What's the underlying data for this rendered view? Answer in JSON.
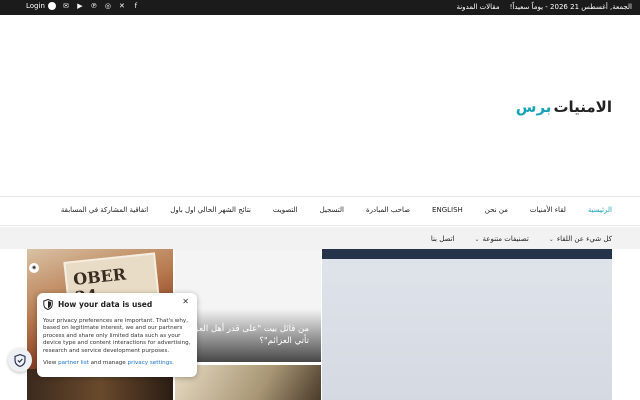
{
  "topbar": {
    "date": "الجمعة, أغسطس 21 2026 - يوماً سعيداً!",
    "blog_articles": "مقالات المدونة",
    "login": "Login",
    "social_icons": [
      "facebook-icon",
      "x-icon",
      "instagram-icon",
      "pinterest-icon",
      "youtube-icon",
      "email-icon"
    ]
  },
  "logo": {
    "part1": "الامنيات",
    "part2": "برس"
  },
  "nav_main": [
    {
      "label": "الرئيسية",
      "active": true
    },
    {
      "label": "لقاء الأمنيات"
    },
    {
      "label": "من نحن"
    },
    {
      "label": "ENGLISH"
    },
    {
      "label": "صاحب المبادرة"
    },
    {
      "label": "التسجيل"
    },
    {
      "label": "التصويت"
    },
    {
      "label": "نتائج الشهر الحالي اول باول"
    },
    {
      "label": "اتفاقية المشاركة في المسابقة"
    }
  ],
  "nav_sub": [
    {
      "label": "كل شيء عن اللقاء"
    },
    {
      "label": "تصنيفات متنوعة"
    },
    {
      "label": "اتصل بنا"
    }
  ],
  "cards": {
    "card1_poster_text": "OBER\n24",
    "card2_caption": "من قائل بيت \"على قدر أهل العزم تأتي العزائم\"؟"
  },
  "privacy": {
    "title": "How your data is used",
    "body": "Your privacy preferences are important. That's why, based on legitimate interest, we and our partners process and share only limited data such as your device type and content interactions for advertising, research and service development purposes.",
    "links_prefix": "View",
    "partner_list": "partner list",
    "links_middle": "and manage",
    "privacy_settings": "privacy settings",
    "links_suffix": "."
  },
  "colors": {
    "accent": "#1aa3b8",
    "topbar": "#1b1b1b"
  }
}
